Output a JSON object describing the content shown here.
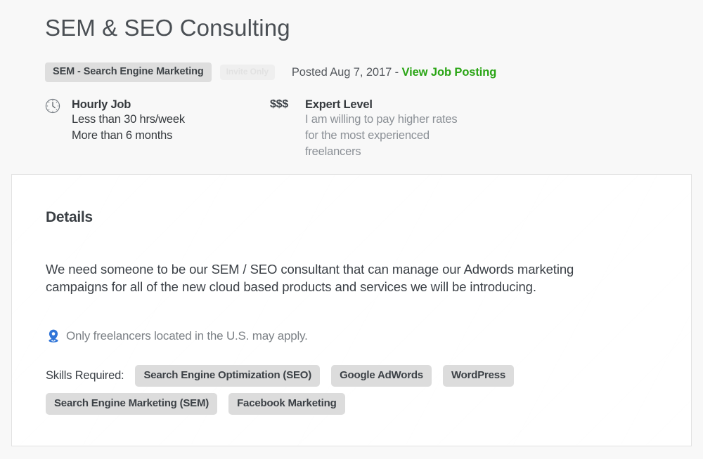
{
  "job": {
    "title": "SEM & SEO Consulting",
    "category_tag": "SEM - Search Engine Marketing",
    "invite_only_tag": "Invite Only",
    "posted_text": "Posted Aug 7, 2017 - ",
    "posting_link_label": "View Job Posting",
    "link_color": "#2aa515"
  },
  "terms": {
    "schedule": {
      "icon": "clock-icon",
      "heading": "Hourly Job",
      "line1": "Less than 30 hrs/week",
      "line2": "More than 6 months"
    },
    "experience": {
      "icon": "money-level-icon",
      "price_level": "$$$",
      "heading": "Expert Level",
      "line1": "I am willing to pay higher rates",
      "line2": "for the most experienced",
      "line3": "freelancers"
    }
  },
  "details": {
    "heading": "Details",
    "body": "We need someone to be our SEM / SEO consultant that can manage our Adwords marketing campaigns for all of the new cloud based products and services we will be introducing.",
    "location": {
      "icon": "map-pin-icon",
      "icon_color": "#3075d8",
      "text": "Only freelancers located in the U.S. may apply."
    },
    "skills_label": "Skills Required:",
    "skills": [
      "Search Engine Optimization (SEO)",
      "Google AdWords",
      "WordPress",
      "Search Engine Marketing (SEM)",
      "Facebook Marketing"
    ]
  }
}
